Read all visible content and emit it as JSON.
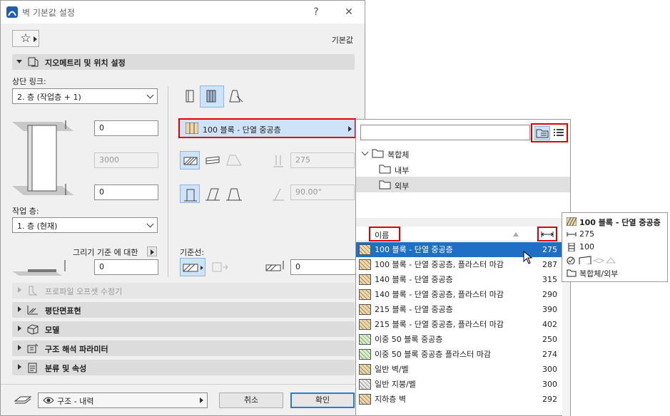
{
  "window": {
    "title": "벽 기본값 설정",
    "help": "?",
    "close": "✕"
  },
  "header": {
    "favorites_label": "☆",
    "default_label": "기본값"
  },
  "geometry_section": {
    "title": "지오메트리 및 위치 설정",
    "top_link_label": "상단 링크:",
    "top_link_value": "2. 층 (작업층 + 1)",
    "top_offset": "0",
    "height": "3000",
    "bottom_offset": "0",
    "home_story_label": "작업 층:",
    "home_story_value": "1. 층 (현재)",
    "draw_ref_label": "그리기 기준 에 대한",
    "draw_ref_value": "0",
    "structure_value": "100 블록 - 단열 중공층",
    "thickness": "275",
    "angle": "90.00°",
    "ref_line_label": "기준선:",
    "ref_line_offset": "0"
  },
  "sections": [
    {
      "label": "프로파일 오프셋 수정기",
      "disabled": true
    },
    {
      "label": "평단면표현"
    },
    {
      "label": "모델"
    },
    {
      "label": "구조 해석 파라미터"
    },
    {
      "label": "분류 및 속성"
    }
  ],
  "footer": {
    "view_value": "구조 - 내력",
    "cancel": "취소",
    "ok": "확인"
  },
  "popup": {
    "search_value": "",
    "tree": [
      {
        "label": "복합체",
        "level": 0
      },
      {
        "label": "내부",
        "level": 1
      },
      {
        "label": "외부",
        "level": 1
      }
    ],
    "column_name": "이름",
    "rows": [
      {
        "name": "100 블록 - 단열 중공층",
        "value": "275",
        "selected": true,
        "color": "#f0d7a8"
      },
      {
        "name": "100 블록 - 단열 중공층, 플라스터 마감",
        "value": "287",
        "color": "#f0d7a8"
      },
      {
        "name": "140 블록 - 단열 중공층",
        "value": "315",
        "color": "#f0d7a8"
      },
      {
        "name": "140 블록 - 단열 중공층, 플라스터 마감",
        "value": "290",
        "color": "#f0d7a8"
      },
      {
        "name": "215 블록 - 단열 중공층",
        "value": "390",
        "color": "#f0d7a8"
      },
      {
        "name": "215 블록 - 단열 중공층, 플라스터 마감",
        "value": "402",
        "color": "#f0d7a8"
      },
      {
        "name": "이중 50 블록 중공층",
        "value": "250",
        "color": "#d8f0c8"
      },
      {
        "name": "이중 50 블록 중공층 플라스터 마감",
        "value": "274",
        "color": "#d8f0c8"
      },
      {
        "name": "일반 벽/벨",
        "value": "300",
        "color": "#e8d8a8"
      },
      {
        "name": "일반 지붕/벨",
        "value": "300",
        "color": "#e8e8e8"
      },
      {
        "name": "지하층 벽",
        "value": "292",
        "color": "#f0d7a8"
      }
    ]
  },
  "tooltip": {
    "name": "100 블록 - 단열 중공층",
    "thickness": "275",
    "core": "100",
    "path": "복합체/외부"
  },
  "colors": {
    "selection": "#1f6fc5",
    "highlight_box": "#e00000",
    "section_bg": "#dcdcdc"
  }
}
